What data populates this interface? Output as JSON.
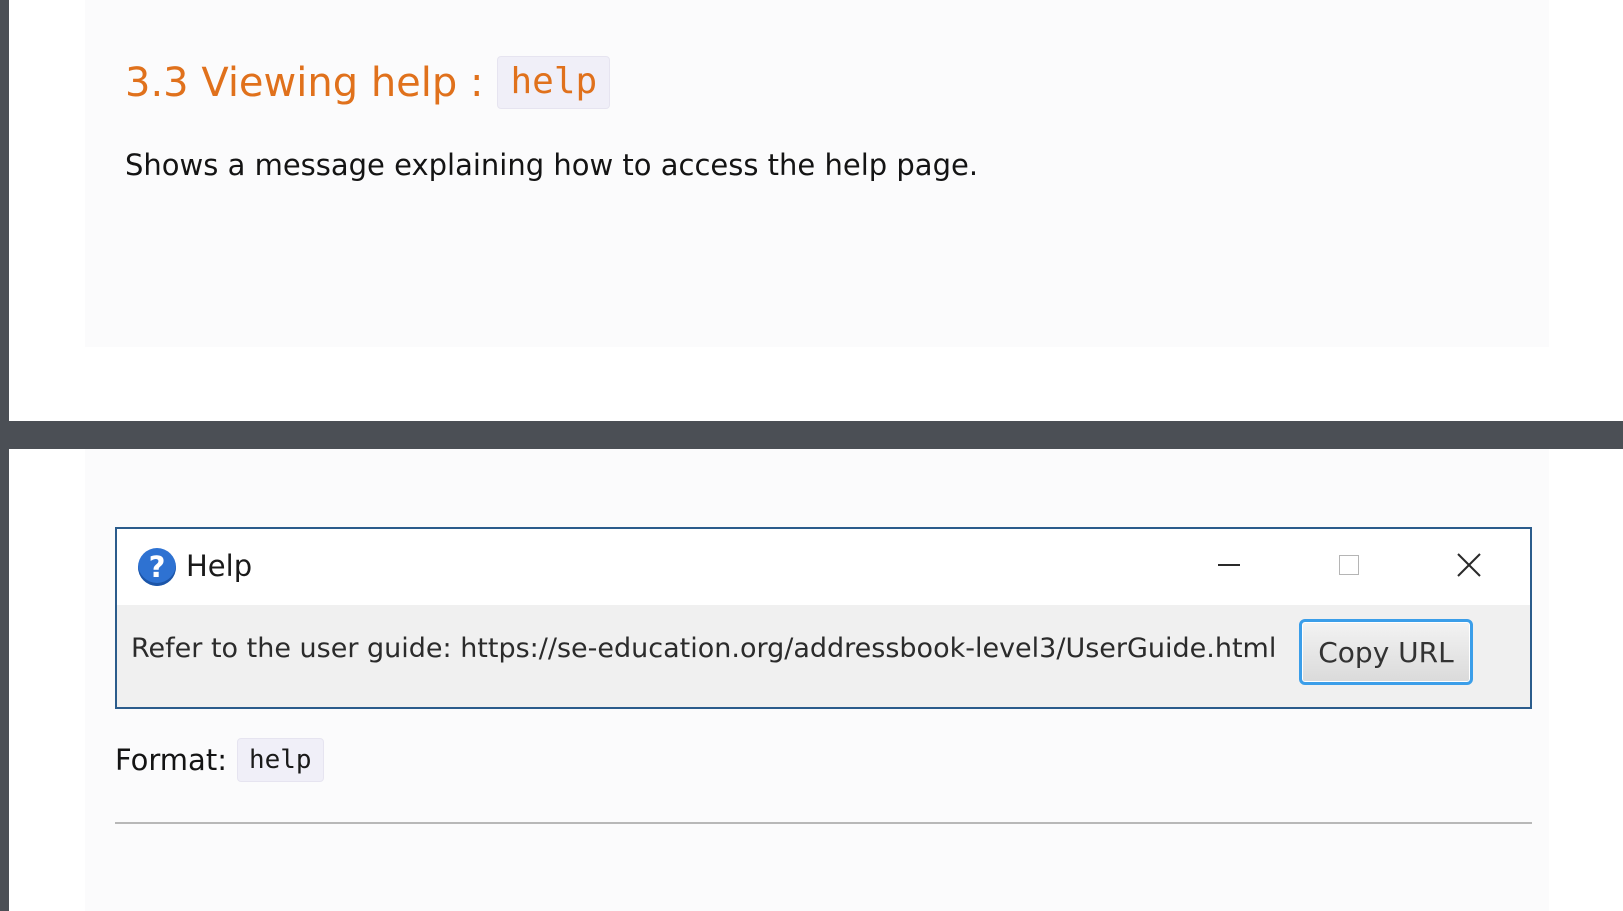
{
  "section": {
    "title": "3.3 Viewing help :",
    "command": "help",
    "description": "Shows a message explaining how to access the help page."
  },
  "help_window": {
    "title": "Help",
    "icon": "question-mark-icon",
    "message": "Refer to the user guide: https://se-education.org/addressbook-level3/UserGuide.html",
    "copy_button_label": "Copy URL",
    "window_controls": [
      "minimize-icon",
      "maximize-icon",
      "close-icon"
    ]
  },
  "format": {
    "label": "Format:",
    "command": "help"
  },
  "colors": {
    "heading": "#e0711c",
    "window_border": "#2b5c8c",
    "button_focus": "#3b9ee9",
    "code_background": "#f0eff8",
    "page_gap": "#4b4f55"
  }
}
